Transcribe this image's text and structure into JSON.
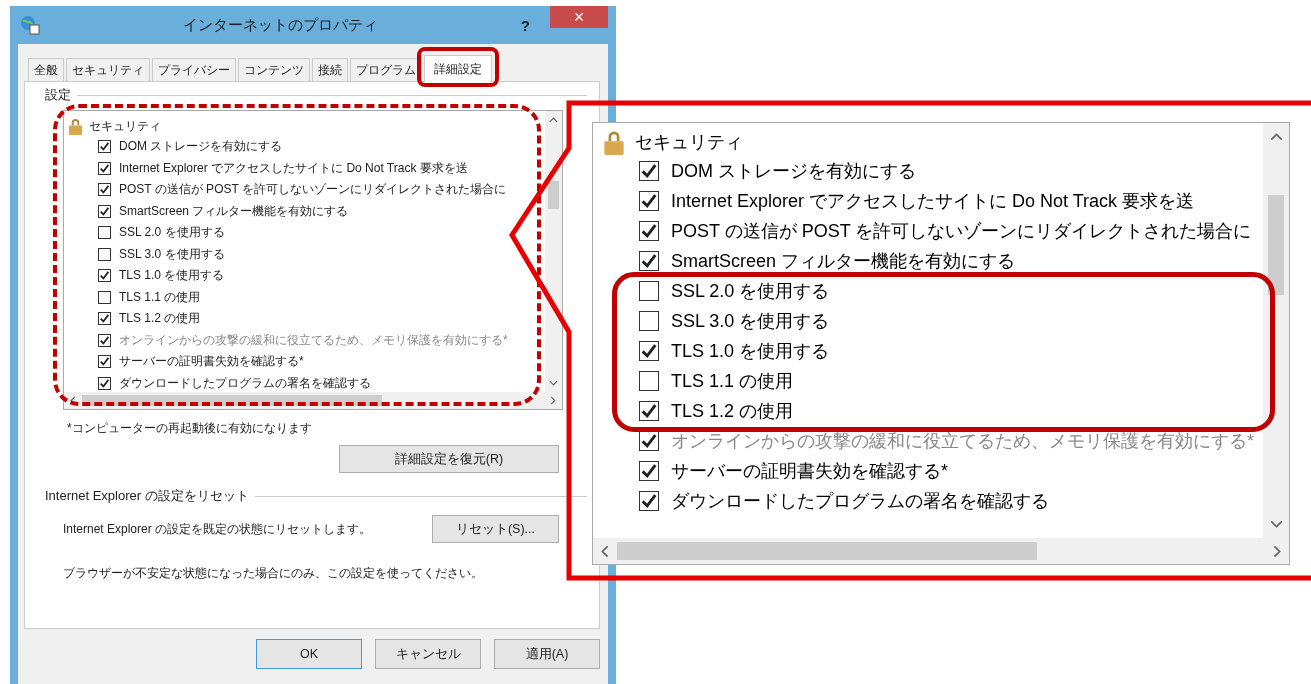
{
  "window": {
    "title": "インターネットのプロパティ",
    "help": "?",
    "close": "×"
  },
  "tabs": [
    {
      "label": "全般",
      "selected": false
    },
    {
      "label": "セキュリティ",
      "selected": false
    },
    {
      "label": "プライバシー",
      "selected": false
    },
    {
      "label": "コンテンツ",
      "selected": false
    },
    {
      "label": "接続",
      "selected": false
    },
    {
      "label": "プログラム",
      "selected": false
    },
    {
      "label": "詳細設定",
      "selected": true
    }
  ],
  "settings_group": {
    "label": "設定",
    "category": "セキュリティ",
    "items": [
      {
        "label": "DOM ストレージを有効にする",
        "checked": true,
        "disabled": false
      },
      {
        "label": "Internet Explorer でアクセスしたサイトに Do Not Track 要求を送",
        "checked": true,
        "disabled": false
      },
      {
        "label": "POST の送信が POST を許可しないゾーンにリダイレクトされた場合に",
        "checked": true,
        "disabled": false
      },
      {
        "label": "SmartScreen フィルター機能を有効にする",
        "checked": true,
        "disabled": false
      },
      {
        "label": "SSL 2.0 を使用する",
        "checked": false,
        "disabled": false
      },
      {
        "label": "SSL 3.0 を使用する",
        "checked": false,
        "disabled": false
      },
      {
        "label": "TLS 1.0 を使用する",
        "checked": true,
        "disabled": false
      },
      {
        "label": "TLS 1.1 の使用",
        "checked": false,
        "disabled": false
      },
      {
        "label": "TLS 1.2 の使用",
        "checked": true,
        "disabled": false
      },
      {
        "label": "オンラインからの攻撃の緩和に役立てるため、メモリ保護を有効にする*",
        "checked": true,
        "disabled": true
      },
      {
        "label": "サーバーの証明書失効を確認する*",
        "checked": true,
        "disabled": false
      },
      {
        "label": "ダウンロードしたプログラムの署名を確認する",
        "checked": true,
        "disabled": false
      }
    ]
  },
  "footnote": "*コンピューターの再起動後に有効になります",
  "restore_button": "詳細設定を復元(R)",
  "reset_group": {
    "label": "Internet Explorer の設定をリセット",
    "description": "Internet Explorer の設定を既定の状態にリセットします。",
    "button": "リセット(S)...",
    "note": "ブラウザーが不安定な状態になった場合にのみ、この設定を使ってください。"
  },
  "buttons": [
    {
      "label": "OK",
      "default": true
    },
    {
      "label": "キャンセル",
      "default": false
    },
    {
      "label": "適用(A)",
      "default": false
    }
  ],
  "callout": {
    "category": "セキュリティ",
    "items": [
      {
        "label": "DOM ストレージを有効にする",
        "checked": true,
        "disabled": false
      },
      {
        "label": "Internet Explorer でアクセスしたサイトに Do Not Track 要求を送",
        "checked": true,
        "disabled": false
      },
      {
        "label": "POST の送信が POST を許可しないゾーンにリダイレクトされた場合に",
        "checked": true,
        "disabled": false
      },
      {
        "label": "SmartScreen フィルター機能を有効にする",
        "checked": true,
        "disabled": false
      },
      {
        "label": "SSL 2.0 を使用する",
        "checked": false,
        "disabled": false
      },
      {
        "label": "SSL 3.0 を使用する",
        "checked": false,
        "disabled": false
      },
      {
        "label": "TLS 1.0 を使用する",
        "checked": true,
        "disabled": false
      },
      {
        "label": "TLS 1.1 の使用",
        "checked": false,
        "disabled": false
      },
      {
        "label": "TLS 1.2 の使用",
        "checked": true,
        "disabled": false
      },
      {
        "label": "オンラインからの攻撃の緩和に役立てるため、メモリ保護を有効にする*",
        "checked": true,
        "disabled": true
      },
      {
        "label": "サーバーの証明書失効を確認する*",
        "checked": true,
        "disabled": false
      },
      {
        "label": "ダウンロードしたプログラムの署名を確認する",
        "checked": true,
        "disabled": false
      }
    ]
  }
}
